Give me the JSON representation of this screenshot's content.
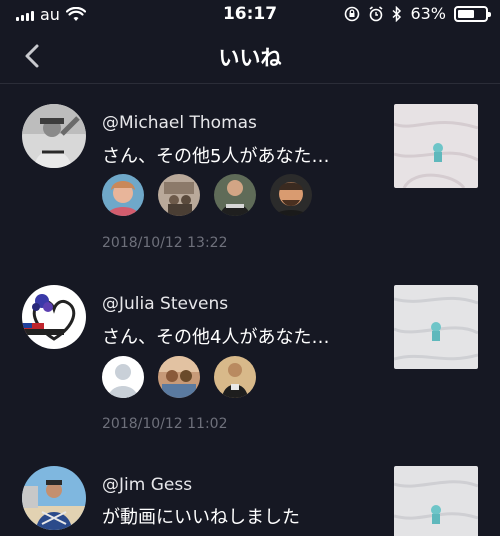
{
  "status": {
    "carrier": "au",
    "time": "16:17",
    "battery_pct": "63%",
    "battery_level": 0.63
  },
  "nav": {
    "back_icon": "chevron-left-icon",
    "title": "いいね"
  },
  "items": [
    {
      "username": "@Michael Thomas",
      "message": "さん、その他5人があなた…",
      "timestamp": "2018/10/12 13:22",
      "likers_count": 4
    },
    {
      "username": "@Julia Stevens",
      "message": "さん、その他4人があなた…",
      "timestamp": "2018/10/12 11:02",
      "likers_count": 3
    },
    {
      "username": "@Jim Gess",
      "message": "が動画にいいねしました"
    }
  ],
  "colors": {
    "background": "#161823",
    "secondary_text": "#6e707b",
    "divider": "#2b2d38"
  }
}
